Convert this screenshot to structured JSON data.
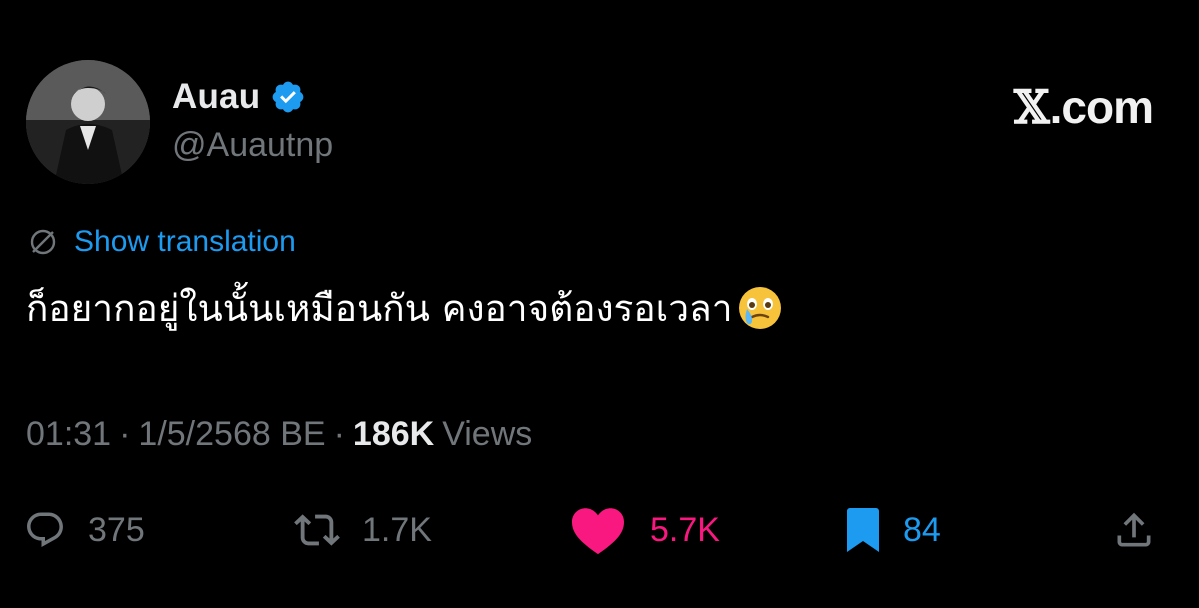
{
  "author": {
    "display_name": "Auau",
    "handle": "@Auautnp",
    "verified": true
  },
  "brand": {
    "x_glyph": "𝕏",
    "text": ".com"
  },
  "translate": {
    "label": "Show translation"
  },
  "tweet": {
    "text": "ก็อยากอยู่ในนั้นเหมือนกัน คงอาจต้องรอเวลา",
    "emoji": "face-holding-back-tears"
  },
  "meta": {
    "time": "01:31",
    "sep1": "·",
    "date": "1/5/2568 BE",
    "sep2": "·",
    "views_count": "186K",
    "views_label": "Views"
  },
  "actions": {
    "replies": "375",
    "reposts": "1.7K",
    "likes": "5.7K",
    "bookmarks": "84"
  },
  "icons": {
    "reply": "reply-icon",
    "repost": "repost-icon",
    "like": "heart-icon",
    "bookmark": "bookmark-icon",
    "share": "share-icon",
    "verified": "verified-badge-icon",
    "translate": "globe-icon"
  },
  "colors": {
    "background": "#000000",
    "text_primary": "#e7e9ea",
    "text_secondary": "#71767b",
    "link_blue": "#1d9bf0",
    "like_pink": "#f91880",
    "bookmark_blue": "#1d9bf0"
  }
}
